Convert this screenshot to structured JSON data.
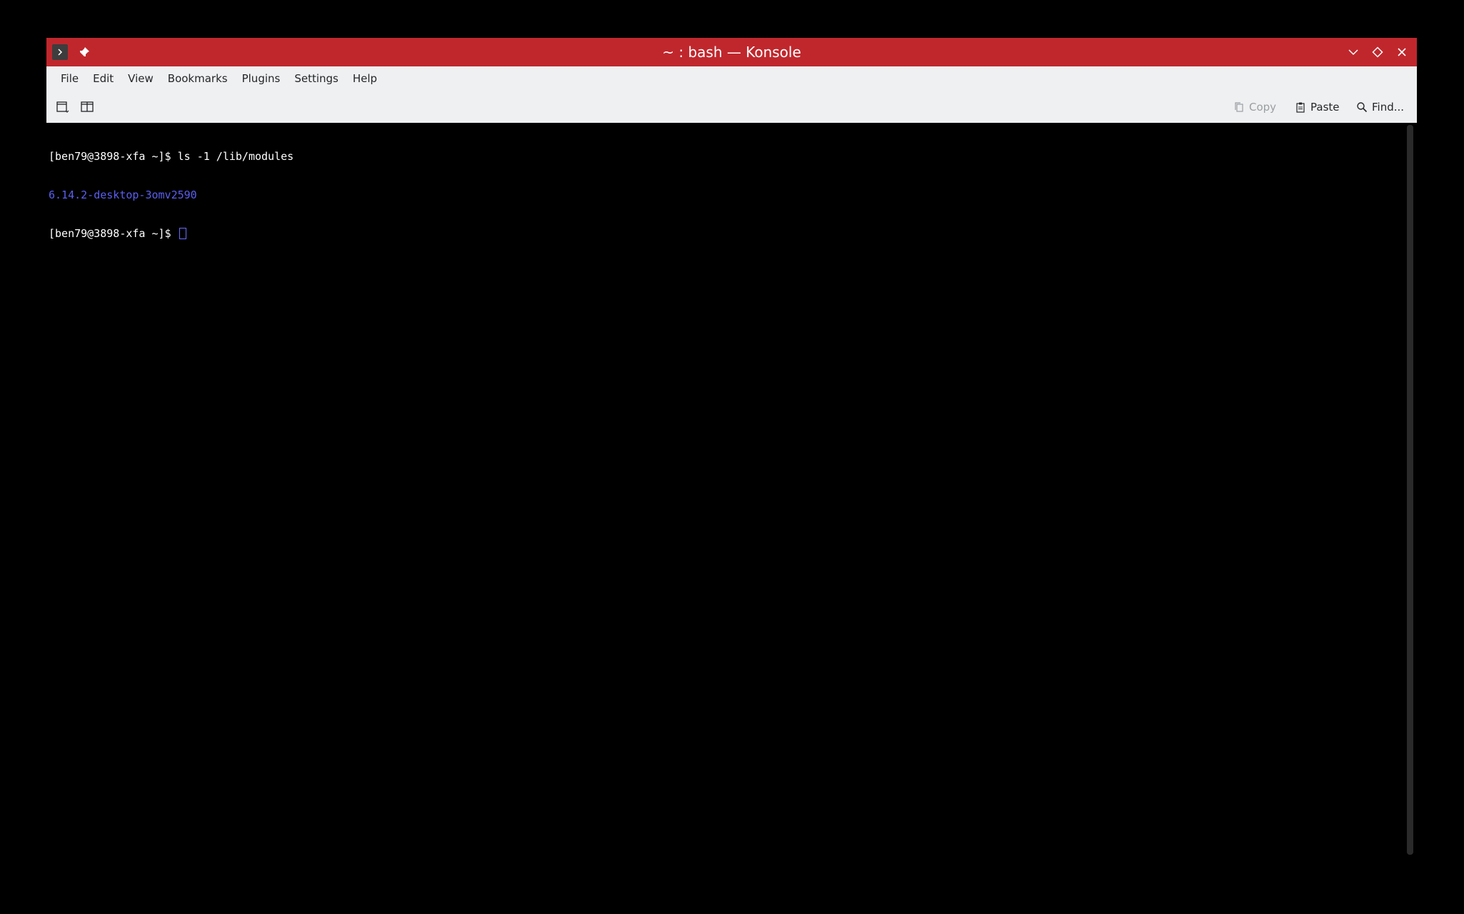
{
  "window": {
    "title": "~ : bash — Konsole"
  },
  "menubar": {
    "items": [
      "File",
      "Edit",
      "View",
      "Bookmarks",
      "Plugins",
      "Settings",
      "Help"
    ]
  },
  "toolbar": {
    "copy_label": "Copy",
    "paste_label": "Paste",
    "find_label": "Find..."
  },
  "terminal": {
    "lines": [
      "[ben79@3898-xfa ~]$ ls -1 /lib/modules",
      "6.14.2-desktop-3omv2590",
      "[ben79@3898-xfa ~]$ "
    ],
    "dir_color": "#5b5ff0"
  },
  "colors": {
    "titlebar": "#c0272d",
    "menubar": "#eff0f1",
    "terminal_bg": "#000000"
  }
}
